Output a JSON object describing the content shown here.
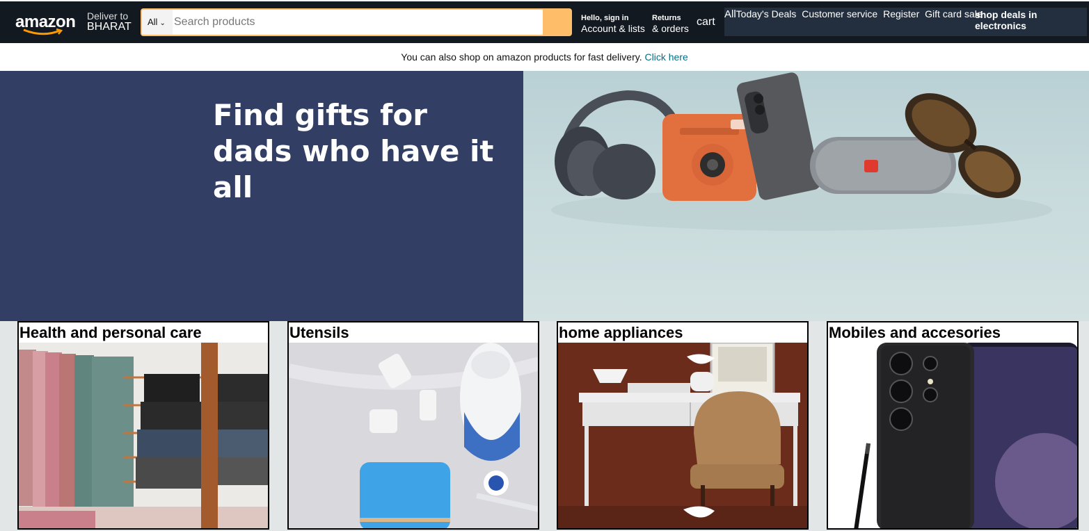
{
  "header": {
    "logo_text": "amazon",
    "deliver_line1": "Deliver to",
    "deliver_line2": "BHARAT",
    "search": {
      "category": "All",
      "placeholder": "Search products"
    },
    "account_line1": "Hello, sign in",
    "account_line2": "Account & lists",
    "returns_line1": "Returns",
    "returns_line2": "& orders",
    "cart_label": "cart",
    "subnav": {
      "all": "All",
      "links": [
        "Today's Deals",
        "Customer service",
        "Register",
        "Gift card sale"
      ],
      "deals": "shop deals in electronics"
    }
  },
  "notice": {
    "text": "You can also shop on amazon products for fast delivery.",
    "link": "Click here"
  },
  "hero": {
    "title_line1": "Find gifts for",
    "title_line2": "dads who have it all"
  },
  "cards": [
    {
      "title": "Health and personal care"
    },
    {
      "title": "Utensils"
    },
    {
      "title": "home appliances"
    },
    {
      "title": "Mobiles and accesories"
    }
  ],
  "colors": {
    "nav_bg": "#131921",
    "subnav_bg": "#232f3e",
    "search_accent": "#febd69",
    "hero_left": "#323e64",
    "link": "#007185"
  }
}
